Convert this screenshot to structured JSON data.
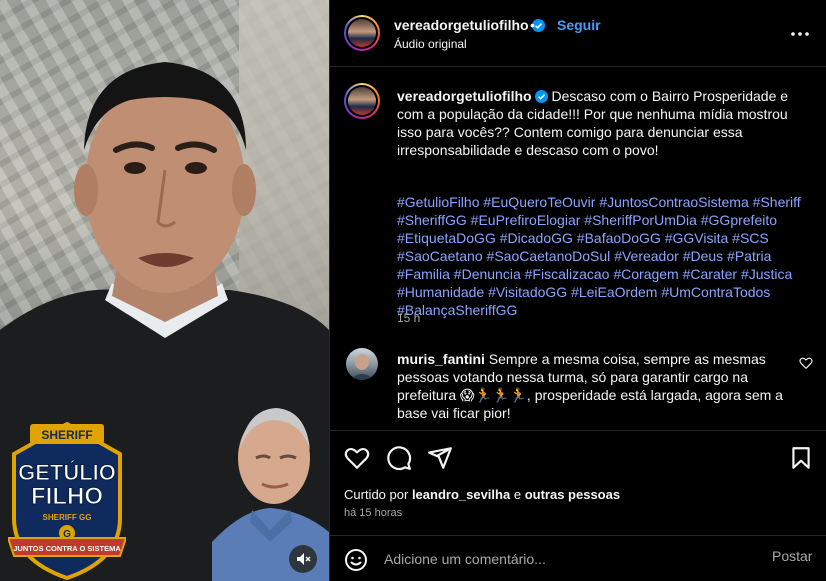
{
  "post": {
    "username": "vereadorgetuliofilho",
    "dot": "•",
    "follow_label": "Seguir",
    "audio_label": "Áudio original"
  },
  "caption": {
    "username": "vereadorgetuliofilho",
    "text": "Descaso com o Bairro Prosperidade e com a população da cidade!!! Por que nenhuma mídia mostrou isso para vocês?? Contem comigo para denunciar essa irresponsabilidade e descaso com o povo!",
    "hashtags": [
      "#GetulioFilho",
      "#EuQueroTeOuvir",
      "#JuntosContraoSistema",
      "#Sheriff",
      "#SheriffGG",
      "#EuPrefiroElogiar",
      "#SheriffPorUmDia",
      "#GGprefeito",
      "#EtiquetaDoGG",
      "#DicadoGG",
      "#BafaoDoGG",
      "#GGVisita",
      "#SCS",
      "#SaoCaetano",
      "#SaoCaetanoDoSul",
      "#Vereador",
      "#Deus",
      "#Patria",
      "#Familia",
      "#Denuncia",
      "#Fiscalizacao",
      "#Coragem",
      "#Carater",
      "#Justica",
      "#Humanidade",
      "#VisitadoGG",
      "#LeiEaOrdem",
      "#UmContraTodos",
      "#BalançaSheriffGG"
    ],
    "time": "15 h"
  },
  "comment": {
    "username": "muris_fantini",
    "text": "Sempre a mesma coisa, sempre as mesmas pessoas votando nessa turma, só para garantir cargo na prefeitura 😱🏃🏃🏃, prosperidade está largada, agora sem a base vai ficar pior!"
  },
  "likes": {
    "prefix": "Curtido por",
    "user": "leandro_sevilha",
    "middle": "e",
    "others": "outras pessoas"
  },
  "posted_ago": "há 15 horas",
  "add_comment": {
    "placeholder": "Adicione um comentário...",
    "post_label": "Postar"
  },
  "video_overlay": {
    "badge_top": "SHERIFF",
    "name_line1": "GETÚLIO",
    "name_line2": "FILHO",
    "sub": "SHERIFF GG",
    "ribbon": "JUNTOS CONTRA O SISTEMA",
    "letter": "G"
  },
  "colors": {
    "link": "#4a9cf6",
    "hashtag": "#8aa4ff",
    "muted": "#a8a8a8",
    "badge_gold": "#e0a400",
    "badge_navy": "#0f2a5c"
  },
  "icons": [
    "verified-icon",
    "more-icon",
    "heart-icon",
    "comment-icon",
    "share-icon",
    "bookmark-icon",
    "emoji-icon",
    "mute-icon"
  ]
}
